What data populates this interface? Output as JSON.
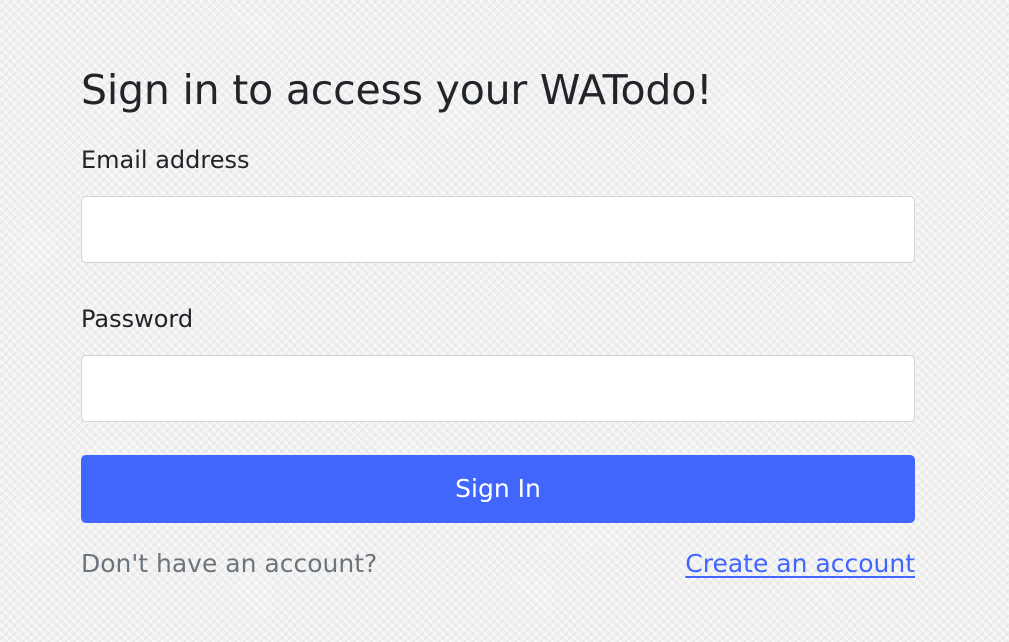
{
  "form": {
    "title": "Sign in to access your WATodo!",
    "email_label": "Email address",
    "email_value": "",
    "password_label": "Password",
    "password_value": "",
    "submit_label": "Sign In",
    "no_account_text": "Don't have an account?",
    "create_account_link": "Create an account"
  },
  "colors": {
    "accent": "#4166fb",
    "muted_text": "#6c757d",
    "text": "#212529",
    "input_border": "#ced4da"
  }
}
